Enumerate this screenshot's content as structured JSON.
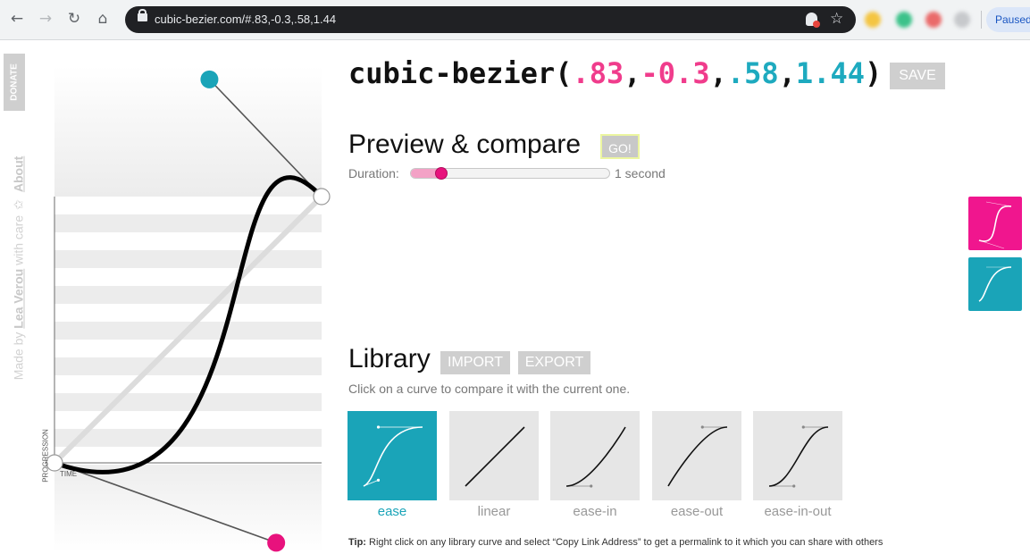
{
  "browser": {
    "url": "cubic-bezier.com/#.83,-0.3,.58,1.44",
    "paused_label": "Paused",
    "icons": [
      "back-icon",
      "forward-icon",
      "reload-icon",
      "home-icon",
      "lock-icon",
      "extension-icon",
      "star-icon"
    ]
  },
  "sidebar": {
    "donate": "DONATE",
    "made_by_prefix": "Made by",
    "author": "Lea Verou",
    "with_care": "with care",
    "about": "About"
  },
  "editor": {
    "y_axis_label": "PROGRESSION",
    "x_axis_label": "TIME",
    "control_points": {
      "p1": [
        0.83,
        -0.3
      ],
      "p2": [
        0.58,
        1.44
      ]
    }
  },
  "header": {
    "prefix": "cubic-bezier(",
    "p1x": ".83",
    "p1y": "-0.3",
    "p2x": ".58",
    "p2y": "1.44",
    "sep": ",",
    "suffix": ")",
    "save_label": "SAVE"
  },
  "preview": {
    "heading": "Preview & compare",
    "go_label": "GO!",
    "duration_label": "Duration:",
    "duration_value": "1 second",
    "duration_fraction": 0.12,
    "swatch_colors": [
      "#f0168e",
      "#1aa4b8"
    ]
  },
  "library": {
    "heading": "Library",
    "import_label": "IMPORT",
    "export_label": "EXPORT",
    "hint": "Click on a curve to compare it with the current one.",
    "items": [
      {
        "label": "ease",
        "active": true,
        "curve": [
          0.25,
          0.1,
          0.25,
          1.0
        ]
      },
      {
        "label": "linear",
        "active": false,
        "curve": [
          0.0,
          0.0,
          1.0,
          1.0
        ]
      },
      {
        "label": "ease-in",
        "active": false,
        "curve": [
          0.42,
          0.0,
          1.0,
          1.0
        ]
      },
      {
        "label": "ease-out",
        "active": false,
        "curve": [
          0.0,
          0.0,
          0.58,
          1.0
        ]
      },
      {
        "label": "ease-in-out",
        "active": false,
        "curve": [
          0.42,
          0.0,
          0.58,
          1.0
        ]
      }
    ]
  },
  "tip": {
    "label": "Tip:",
    "text": " Right click on any library curve and select “Copy Link Address” to get a permalink to it which you can share with others"
  },
  "colors": {
    "pink": "#f03c8c",
    "teal": "#1eaabf",
    "handle_pink": "#e8127d",
    "handle_teal": "#1aa4b8"
  }
}
